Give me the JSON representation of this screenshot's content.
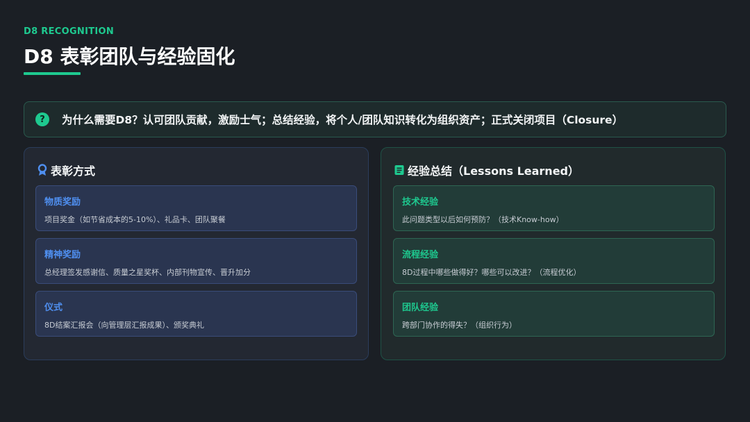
{
  "header": {
    "eyebrow": "D8 RECOGNITION",
    "title": "D8 表彰团队与经验固化"
  },
  "banner": {
    "icon": "question-circle-icon",
    "icon_glyph": "?",
    "text": "为什么需要D8？认可团队贡献，激励士气；总结经验，将个人/团队知识转化为组织资产；正式关闭项目（Closure）"
  },
  "left_panel": {
    "icon": "award-ribbon-icon",
    "title": "表彰方式",
    "cards": [
      {
        "title": "物质奖励",
        "desc": "项目奖金（如节省成本的5-10%）、礼品卡、团队聚餐"
      },
      {
        "title": "精神奖励",
        "desc": "总经理签发感谢信、质量之星奖杯、内部刊物宣传、晋升加分"
      },
      {
        "title": "仪式",
        "desc": "8D结案汇报会（向管理层汇报成果）、颁奖典礼"
      }
    ]
  },
  "right_panel": {
    "icon": "notebook-icon",
    "title": "经验总结（Lessons Learned）",
    "cards": [
      {
        "title": "技术经验",
        "desc": "此问题类型以后如何预防？（技术Know-how）"
      },
      {
        "title": "流程经验",
        "desc": "8D过程中哪些做得好？哪些可以改进？（流程优化）"
      },
      {
        "title": "团队经验",
        "desc": "跨部门协作的得失？（组织行为）"
      }
    ]
  },
  "colors": {
    "accent_green": "#1ec98f",
    "accent_blue": "#4f8ff0",
    "background": "#1b1f25"
  }
}
